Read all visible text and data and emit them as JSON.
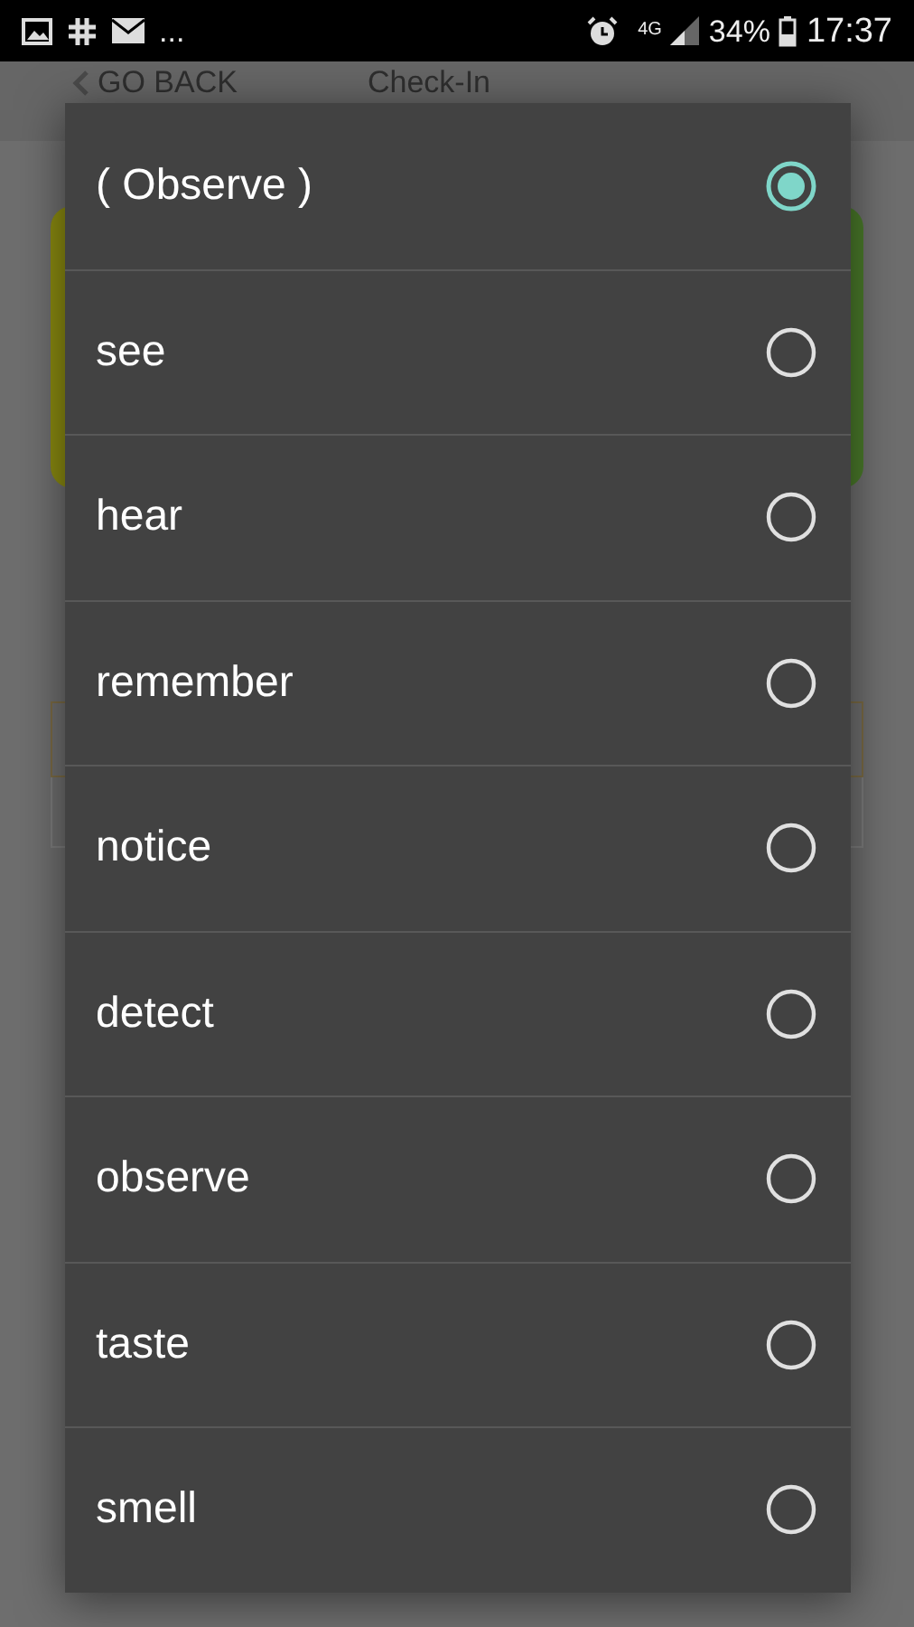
{
  "status_bar": {
    "overflow": "...",
    "network": "4G",
    "battery": "34%",
    "time": "17:37"
  },
  "app_bar": {
    "back": "GO BACK",
    "title": "Check-In"
  },
  "dialog": {
    "options": [
      {
        "label": "( Observe )",
        "selected": true
      },
      {
        "label": "see",
        "selected": false
      },
      {
        "label": "hear",
        "selected": false
      },
      {
        "label": "remember",
        "selected": false
      },
      {
        "label": "notice",
        "selected": false
      },
      {
        "label": "detect",
        "selected": false
      },
      {
        "label": "observe",
        "selected": false
      },
      {
        "label": "taste",
        "selected": false
      },
      {
        "label": "smell",
        "selected": false
      }
    ]
  }
}
